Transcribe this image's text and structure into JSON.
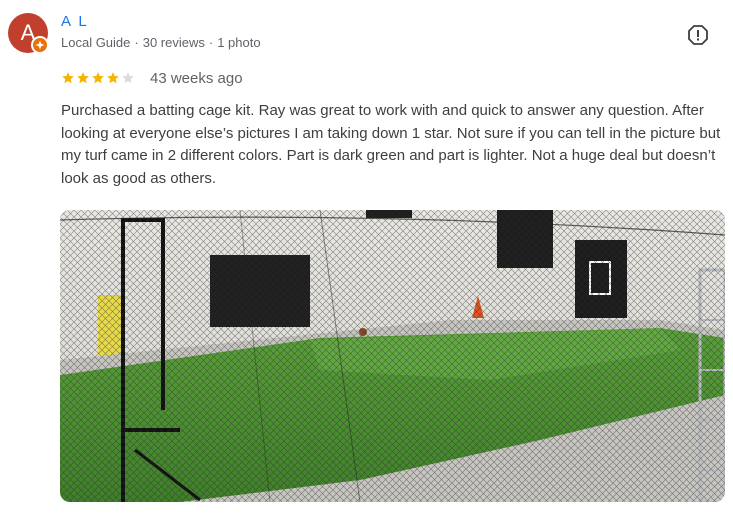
{
  "reviewer": {
    "avatar_letter": "A",
    "name": "A L",
    "guide_label": "Local Guide",
    "reviews_count": "30 reviews",
    "photos_count": "1 photo",
    "separator": "·",
    "avatar_color": "#c0402d",
    "badge_color": "#e8710a",
    "name_color": "#1a73e8"
  },
  "review": {
    "rating": 4,
    "max_rating": 5,
    "star_color": "#f4b400",
    "time": "43 weeks ago",
    "text": "Purchased a batting cage kit. Ray was great to work with and quick to answer any question. After looking at everyone else’s pictures I am taking down 1 star. Not sure if you can tell in the picture but my turf came in 2 different colors. Part is dark green and part is lighter. Not a huge deal but doesn’t look as good as others."
  },
  "actions": {
    "report_icon": "report-flag-icon"
  },
  "photo": {
    "subject": "batting-cage-photo"
  }
}
